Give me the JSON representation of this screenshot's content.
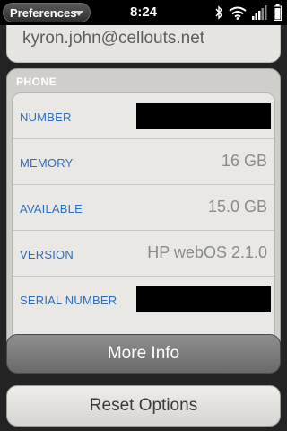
{
  "status_bar": {
    "app_menu_label": "Preferences",
    "time": "8:24"
  },
  "account": {
    "email": "kyron.john@cellouts.net"
  },
  "phone": {
    "header": "PHONE",
    "rows": [
      {
        "label": "NUMBER",
        "value": ""
      },
      {
        "label": "MEMORY",
        "value": "16 GB"
      },
      {
        "label": "AVAILABLE",
        "value": "15.0 GB"
      },
      {
        "label": "VERSION",
        "value": "HP webOS 2.1.0"
      },
      {
        "label": "SERIAL NUMBER",
        "value": ""
      }
    ]
  },
  "buttons": {
    "more_info": "More Info",
    "reset_options": "Reset Options"
  },
  "colors": {
    "label_blue": "#2e6fbc",
    "value_gray": "#8a8a8a"
  },
  "icons": [
    "bluetooth-icon",
    "wifi-icon",
    "signal-bars-icon",
    "battery-icon"
  ]
}
